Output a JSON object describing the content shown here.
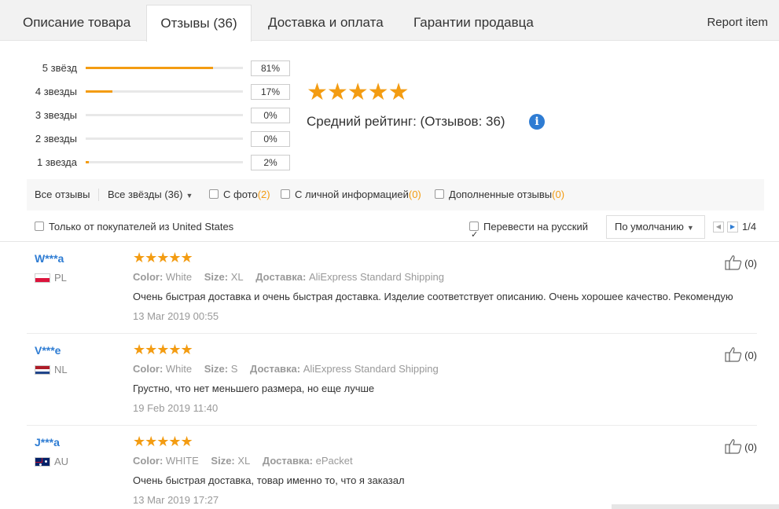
{
  "tabs": [
    {
      "label": "Описание товара"
    },
    {
      "label": "Отзывы (36)"
    },
    {
      "label": "Доставка и оплата"
    },
    {
      "label": "Гарантии продавца"
    }
  ],
  "report_label": "Report item",
  "distribution": [
    {
      "label": "5 звёзд",
      "percent": 81,
      "percent_label": "81%"
    },
    {
      "label": "4 звезды",
      "percent": 17,
      "percent_label": "17%"
    },
    {
      "label": "3 звезды",
      "percent": 0,
      "percent_label": "0%"
    },
    {
      "label": "2 звезды",
      "percent": 0,
      "percent_label": "0%"
    },
    {
      "label": "1 звезда",
      "percent": 2,
      "percent_label": "2%"
    }
  ],
  "summary": {
    "stars": "★★★★★",
    "avg_label": "Средний рейтинг:  (Отзывов: 36)",
    "info_glyph": "i"
  },
  "filters": {
    "all_reviews": "Все отзывы",
    "all_stars": "Все звёзды (36)",
    "with_photo_label": "С фото",
    "with_photo_count": "(2)",
    "personal_info_label": "С личной информацией",
    "personal_info_count": "(0)",
    "additional_label": "Дополненные отзывы",
    "additional_count": "(0)",
    "only_country": "Только от покупателей из United States",
    "translate": "Перевести на русский",
    "sort_label": "По умолчанию",
    "page": "1/4"
  },
  "reviews": [
    {
      "name": "W***a",
      "country": "PL",
      "stars": "★★★★★",
      "color_key": "Color:",
      "color_val": "White",
      "size_key": "Size:",
      "size_val": "XL",
      "ship_key": "Доставка:",
      "ship_val": "AliExpress Standard Shipping",
      "text": "Очень быстрая доставка и очень быстрая доставка. Изделие соответствует описанию. Очень хорошее качество. Рекомендую",
      "date": "13 Mar 2019 00:55",
      "likes": "(0)"
    },
    {
      "name": "V***e",
      "country": "NL",
      "stars": "★★★★★",
      "color_key": "Color:",
      "color_val": "White",
      "size_key": "Size:",
      "size_val": "S",
      "ship_key": "Доставка:",
      "ship_val": "AliExpress Standard Shipping",
      "text": "Грустно, что нет меньшего размера, но еще лучше",
      "date": "19 Feb 2019 11:40",
      "likes": "(0)"
    },
    {
      "name": "J***a",
      "country": "AU",
      "stars": "★★★★★",
      "color_key": "Color:",
      "color_val": "WHITE",
      "size_key": "Size:",
      "size_val": "XL",
      "ship_key": "Доставка:",
      "ship_val": "ePacket",
      "text": "Очень быстрая доставка, товар именно то, что я заказал",
      "date": "13 Mar 2019 17:27",
      "likes": "(0)"
    }
  ],
  "colors": {
    "accent_orange": "#f39c12",
    "link_blue": "#2e7cd3",
    "tab_bg": "#f2f2f2"
  }
}
